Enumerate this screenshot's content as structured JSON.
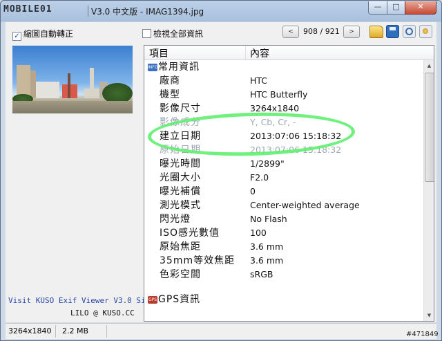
{
  "window": {
    "logo_text": "MOBILE01",
    "title": "V3.0 中文版 - IMAG1394.jpg",
    "controls": {
      "minimize": "—",
      "maximize": "□",
      "close": "✕"
    }
  },
  "toolbar": {
    "auto_rotate_label": "縮圖自動轉正",
    "auto_rotate_checked": "✓",
    "show_all_label": "檢視全部資訊",
    "prev": "<",
    "next": ">",
    "counter": "908 / 921",
    "icons": [
      "folder-icon",
      "save-icon",
      "zoom-icon",
      "settings-icon"
    ]
  },
  "left_panel": {
    "link_text": "Visit KUSO Exif Viewer V3.0 Site",
    "credit_text": "LILO @ KUSO.CC"
  },
  "table": {
    "columns": [
      "項目",
      "內容"
    ],
    "groups": [
      {
        "icon_text": "INFO",
        "label": "常用資訊"
      },
      {
        "icon_text": "GPS",
        "label": "GPS資訊"
      }
    ],
    "rows": [
      {
        "key": "廠商",
        "value": "HTC"
      },
      {
        "key": "機型",
        "value": "HTC Butterfly"
      },
      {
        "key": "影像尺寸",
        "value": "3264x1840"
      },
      {
        "key": "影像成分",
        "value": "Y, Cb, Cr, -"
      },
      {
        "key": "建立日期",
        "value": "2013:07:06 15:18:32"
      },
      {
        "key": "原始日期",
        "value": "2013:07:06 15:18:32"
      },
      {
        "key": "曝光時間",
        "value": "1/2899\""
      },
      {
        "key": "光圈大小",
        "value": "F2.0"
      },
      {
        "key": "曝光補償",
        "value": "0"
      },
      {
        "key": "測光模式",
        "value": "Center-weighted average"
      },
      {
        "key": "閃光燈",
        "value": "No Flash"
      },
      {
        "key": "ISO感光數值",
        "value": "100"
      },
      {
        "key": "原始焦距",
        "value": "3.6 mm"
      },
      {
        "key": "35mm等效焦距",
        "value": "3.6 mm"
      },
      {
        "key": "色彩空間",
        "value": "sRGB"
      }
    ]
  },
  "status": {
    "dimensions": "3264x1840",
    "size": "2.2 MB"
  },
  "watermark": "#471849",
  "colors": {
    "highlight": "#60f070",
    "link": "#2847a8"
  }
}
